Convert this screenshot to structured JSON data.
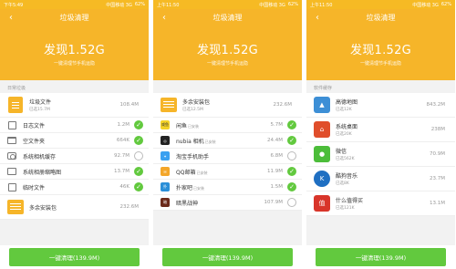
{
  "screens": [
    {
      "status": {
        "time": "下午5:49",
        "carrier": "中国移动 3G",
        "battery": "62%"
      },
      "title": "垃圾清理",
      "found": "发现1.52G",
      "subtitle": "一键清理节手机运隐",
      "section": "日常垃圾",
      "rows": [
        {
          "name": "垃圾文件",
          "meta": "已选15.7M",
          "size": "108.4M",
          "checked": "on"
        },
        {
          "name": "日志文件",
          "size": "1.2M",
          "checked": "on"
        },
        {
          "name": "空文件夹",
          "size": "664K",
          "checked": "on"
        },
        {
          "name": "系统相机缓存",
          "size": "92.7M",
          "checked": "off"
        },
        {
          "name": "系统相册缩略图",
          "size": "13.7M",
          "checked": "on"
        },
        {
          "name": "临时文件",
          "size": "46K",
          "checked": "on"
        },
        {
          "name": "多余安装包",
          "size": "232.6M",
          "checked": ""
        }
      ],
      "button": "一键清理(139.9M)"
    },
    {
      "status": {
        "time": "上午11:50",
        "carrier": "中国移动 3G",
        "battery": "62%"
      },
      "title": "垃圾清理",
      "found": "发现1.52G",
      "subtitle": "一键清理节手机运隐",
      "rows": [
        {
          "name": "多余安装包",
          "meta": "已选12.5M",
          "size": "232.6M",
          "checked": ""
        },
        {
          "name": "闲鱼",
          "tag": "已安装",
          "size": "5.7M",
          "checked": "on",
          "icon_text": "咸鱼"
        },
        {
          "name": "nubia 相机",
          "tag": "已安装",
          "size": "24.4M",
          "checked": "on",
          "icon_text": "◎"
        },
        {
          "name": "淘宝手机助手",
          "tag": "",
          "size": "6.8M",
          "checked": "off",
          "icon_text": "✦"
        },
        {
          "name": "QQ邮箱",
          "tag": "已安装",
          "size": "11.9M",
          "checked": "on",
          "icon_text": "✉"
        },
        {
          "name": "扑家吧",
          "tag": "已安装",
          "size": "1.5M",
          "checked": "on",
          "icon_text": "扑"
        },
        {
          "name": "暗黑战神",
          "tag": "",
          "size": "107.9M",
          "checked": "off",
          "icon_text": "暗"
        }
      ],
      "button": "一键清理(139.9M)"
    },
    {
      "status": {
        "time": "上午11:50",
        "carrier": "中国移动 3G",
        "battery": "62%"
      },
      "title": "垃圾清理",
      "found": "发现1.52G",
      "subtitle": "一键清理节手机运隐",
      "section": "软件缓存",
      "rows": [
        {
          "name": "高德地图",
          "meta": "已选12K",
          "size": "843.2M",
          "checked": "",
          "icon_text": "▲"
        },
        {
          "name": "系统桌面",
          "meta": "已选20K",
          "size": "238M",
          "checked": "",
          "icon_text": "⌂"
        },
        {
          "name": "微信",
          "meta": "已选562K",
          "size": "70.9M",
          "checked": "",
          "icon_text": "●"
        },
        {
          "name": "酷狗音乐",
          "meta": "已选8K",
          "size": "23.7M",
          "checked": "",
          "icon_text": "K"
        },
        {
          "name": "什么值得买",
          "meta": "已选121K",
          "size": "13.1M",
          "checked": "",
          "icon_text": "值"
        }
      ],
      "button": "一键清理(139.9M)"
    }
  ],
  "colors": {
    "header": "#f6b529",
    "button": "#62c93e",
    "check_on": "#62c93e"
  }
}
